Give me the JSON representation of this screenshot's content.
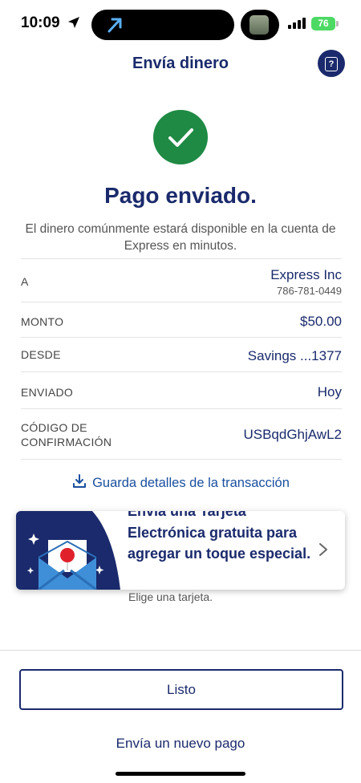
{
  "status_bar": {
    "time": "10:09",
    "battery": "76"
  },
  "header": {
    "title": "Envía dinero",
    "help_label": "?"
  },
  "success": {
    "title": "Pago enviado.",
    "message": "El dinero comúnmente estará disponible en la cuenta de Express en minutos."
  },
  "details": {
    "to_label": "A",
    "to_name": "Express Inc",
    "to_phone": "786-781-0449",
    "amount_label": "MONTO",
    "amount_value": "$50.00",
    "from_label": "DESDE",
    "from_value": "Savings ...1377",
    "sent_label": "ENVIADO",
    "sent_value": "Hoy",
    "code_label_line1": "CÓDIGO DE",
    "code_label_line2": "CONFIRMACIÓN",
    "code_value": "USBqdGhjAwL2"
  },
  "save_details": "Guarda detalles de la transacción",
  "ecard": {
    "text": "Envía una Tarjeta Electrónica gratuita para agregar un toque especial.",
    "subtext": "Elige una tarjeta."
  },
  "done_button": "Listo",
  "new_payment_link": "Envía un nuevo pago",
  "colors": {
    "navy": "#1a2a6c",
    "success_green": "#1f8a44",
    "link_blue": "#1a4fa0"
  },
  "icons": [
    "location-arrow-icon",
    "signal-icon",
    "battery-icon",
    "help-icon",
    "checkmark-icon",
    "download-icon",
    "envelope-card-icon",
    "chevron-right-icon"
  ]
}
